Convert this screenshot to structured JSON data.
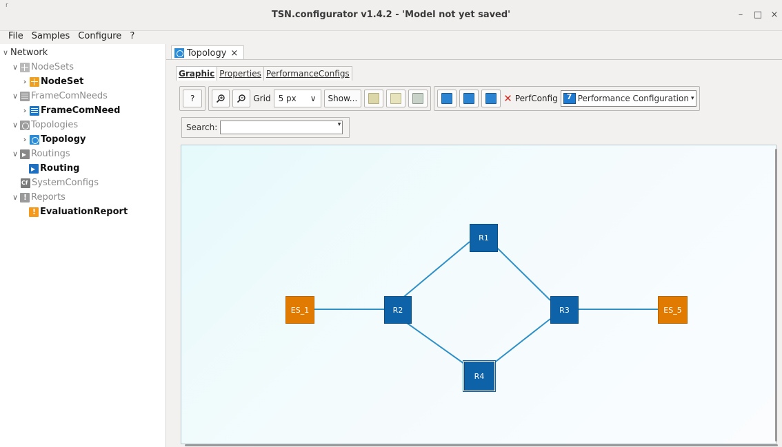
{
  "window": {
    "title": "TSN.configurator v1.4.2 - 'Model not yet saved'",
    "corner_mark": "r",
    "minimize": "–",
    "maximize": "□",
    "close": "×"
  },
  "menu": [
    "File",
    "Samples",
    "Configure",
    "?"
  ],
  "tree": {
    "root": "Network",
    "items": [
      {
        "label": "NodeSets",
        "chevron": "∨"
      },
      {
        "label": "NodeSet",
        "chevron": "›"
      },
      {
        "label": "FrameComNeeds",
        "chevron": "∨"
      },
      {
        "label": "FrameComNeed",
        "chevron": "›"
      },
      {
        "label": "Topologies",
        "chevron": "∨"
      },
      {
        "label": "Topology",
        "chevron": "›"
      },
      {
        "label": "Routings",
        "chevron": "∨"
      },
      {
        "label": "Routing",
        "chevron": ""
      },
      {
        "label": "SystemConfigs",
        "chevron": ""
      },
      {
        "label": "Reports",
        "chevron": "∨"
      },
      {
        "label": "EvaluationReport",
        "chevron": ""
      }
    ],
    "root_chevron": "∨"
  },
  "editor": {
    "tab_label": "Topology",
    "tab_close": "×",
    "subtabs": [
      "Graphic",
      "Properties",
      "PerformanceConfigs"
    ]
  },
  "toolbar": {
    "help": "?",
    "zoom_in": "⚲",
    "zoom_out": "⚲",
    "grid_label": "Grid",
    "grid_value": "5 px",
    "grid_arrow": "∨",
    "show_label": "Show...",
    "perfconfig_label": "PerfConfig",
    "perf_value": "Performance Configuration",
    "dd_arrow": "▾",
    "delete": "✕"
  },
  "search": {
    "label": "Search:",
    "value": "",
    "arrow": "▾"
  },
  "topology": {
    "nodes": [
      "R1",
      "R2",
      "R3",
      "R4",
      "ES_1",
      "ES_5"
    ],
    "selected": "R4"
  },
  "colors": {
    "router": "#0e62a8",
    "end_station": "#e07a00",
    "link": "#2f8fc7"
  }
}
